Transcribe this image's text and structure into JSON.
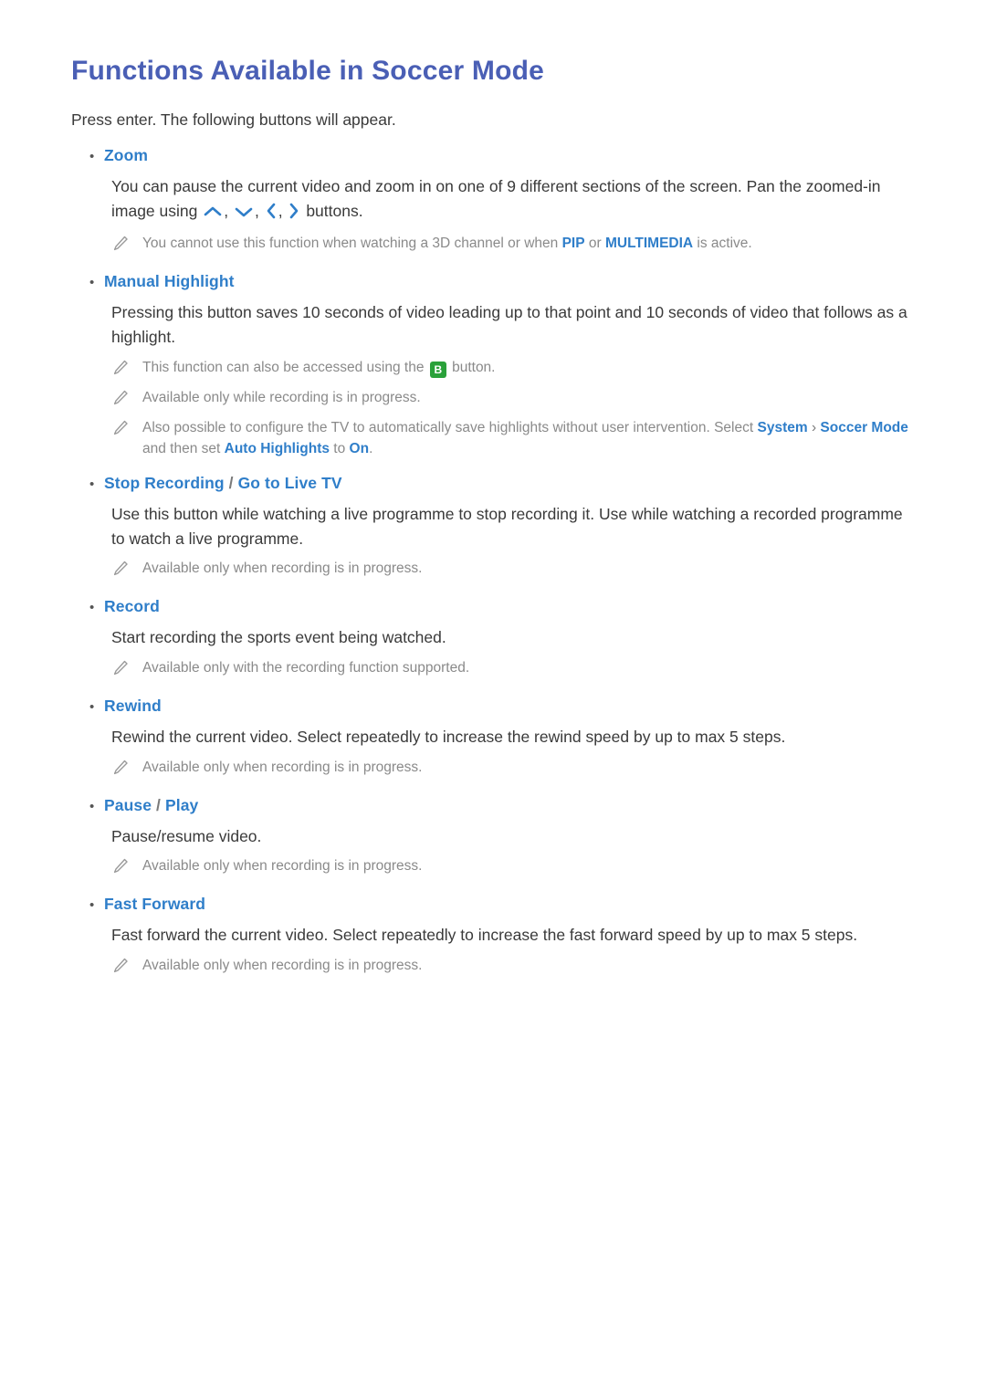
{
  "page": {
    "title": "Functions Available in Soccer Mode",
    "intro": "Press enter. The following buttons will appear."
  },
  "sections": [
    {
      "label": "Zoom",
      "body_before_icons": "You can pause the current video and zoom in on one of 9 different sections of the screen. Pan the zoomed-in image using",
      "body_after_icons": "buttons.",
      "notes": [
        {
          "pre": "You cannot use this function when watching a 3D channel or when ",
          "hl1": "PIP",
          "mid": " or ",
          "hl2": "MULTIMEDIA",
          "post": " is active."
        }
      ]
    },
    {
      "label": "Manual Highlight",
      "body": "Pressing this button saves 10 seconds of video leading up to that point and 10 seconds of video that follows as a highlight.",
      "notes": [
        {
          "pre": "This function can also be accessed using the ",
          "button": "B",
          "post": " button."
        },
        {
          "pre": "Available only while recording is in progress."
        },
        {
          "pre": "Also possible to configure the TV to automatically save highlights without user intervention. Select ",
          "hl1": "System",
          "chev": " › ",
          "hl2": "Soccer Mode",
          "mid": " and then set ",
          "hl3": "Auto Highlights",
          "mid2": " to ",
          "hl4": "On",
          "post": "."
        }
      ]
    },
    {
      "label_a": "Stop Recording",
      "label_sep": " / ",
      "label_b": "Go to Live TV",
      "body": "Use this button while watching a live programme to stop recording it. Use while watching a recorded programme to watch a live programme.",
      "notes": [
        {
          "pre": "Available only when recording is in progress."
        }
      ]
    },
    {
      "label": "Record",
      "body": "Start recording the sports event being watched.",
      "notes": [
        {
          "pre": "Available only with the recording function supported."
        }
      ]
    },
    {
      "label": "Rewind",
      "body": "Rewind the current video. Select repeatedly to increase the rewind speed by up to max 5 steps.",
      "notes": [
        {
          "pre": "Available only when recording is in progress."
        }
      ]
    },
    {
      "label_a": "Pause",
      "label_sep": " / ",
      "label_b": "Play",
      "body": "Pause/resume video.",
      "notes": [
        {
          "pre": "Available only when recording is in progress."
        }
      ]
    },
    {
      "label": "Fast Forward",
      "body": "Fast forward the current video. Select repeatedly to increase the fast forward speed by up to max 5 steps.",
      "notes": [
        {
          "pre": "Available only when recording is in progress."
        }
      ]
    }
  ],
  "icons": {
    "bullet": "•",
    "note": "pencil-icon",
    "up": "chevron-up-icon",
    "down": "chevron-down-icon",
    "left": "chevron-left-icon",
    "right": "chevron-right-icon"
  },
  "colors": {
    "title": "#4a5fb5",
    "link": "#2f7ec9",
    "note": "#8a8a8a",
    "body": "#3a3a3a",
    "button_green": "#2aa13a"
  }
}
